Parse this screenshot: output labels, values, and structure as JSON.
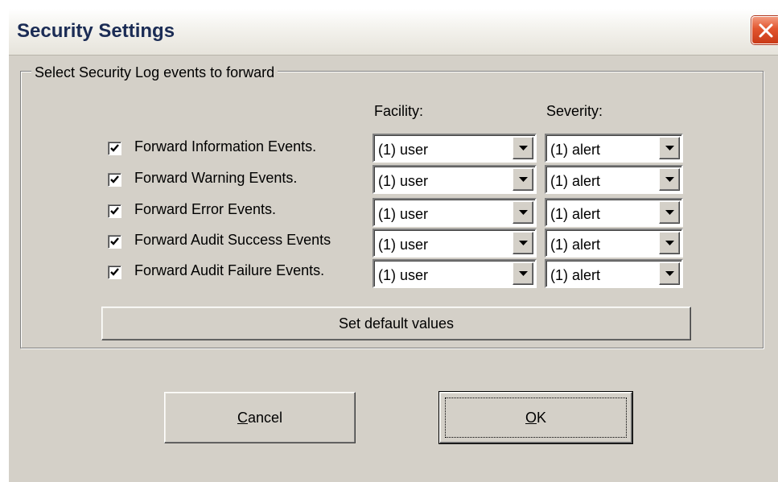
{
  "window": {
    "title": "Security Settings"
  },
  "group": {
    "legend": "Select Security Log events to forward",
    "facility_header": "Facility:",
    "severity_header": "Severity:"
  },
  "rows": [
    {
      "label": "Forward Information Events.",
      "checked": true,
      "facility": "(1) user",
      "severity": "(1) alert"
    },
    {
      "label": "Forward Warning Events.",
      "checked": true,
      "facility": "(1) user",
      "severity": "(1) alert"
    },
    {
      "label": "Forward Error Events.",
      "checked": true,
      "facility": "(1) user",
      "severity": "(1) alert"
    },
    {
      "label": "Forward Audit Success Events",
      "checked": true,
      "facility": "(1) user",
      "severity": "(1) alert"
    },
    {
      "label": "Forward Audit Failure Events.",
      "checked": true,
      "facility": "(1) user",
      "severity": "(1) alert"
    }
  ],
  "buttons": {
    "defaults": "Set default values",
    "cancel_mnemonic": "C",
    "cancel_rest": "ancel",
    "ok_mnemonic": "O",
    "ok_rest": "K"
  },
  "icons": {
    "close": "close-icon",
    "checkmark": "checkmark-icon",
    "dropdown": "chevron-down-icon"
  },
  "colors": {
    "dialog_face": "#d4d0c8",
    "title_text": "#1b2c55",
    "close_button": "#e2552e"
  }
}
